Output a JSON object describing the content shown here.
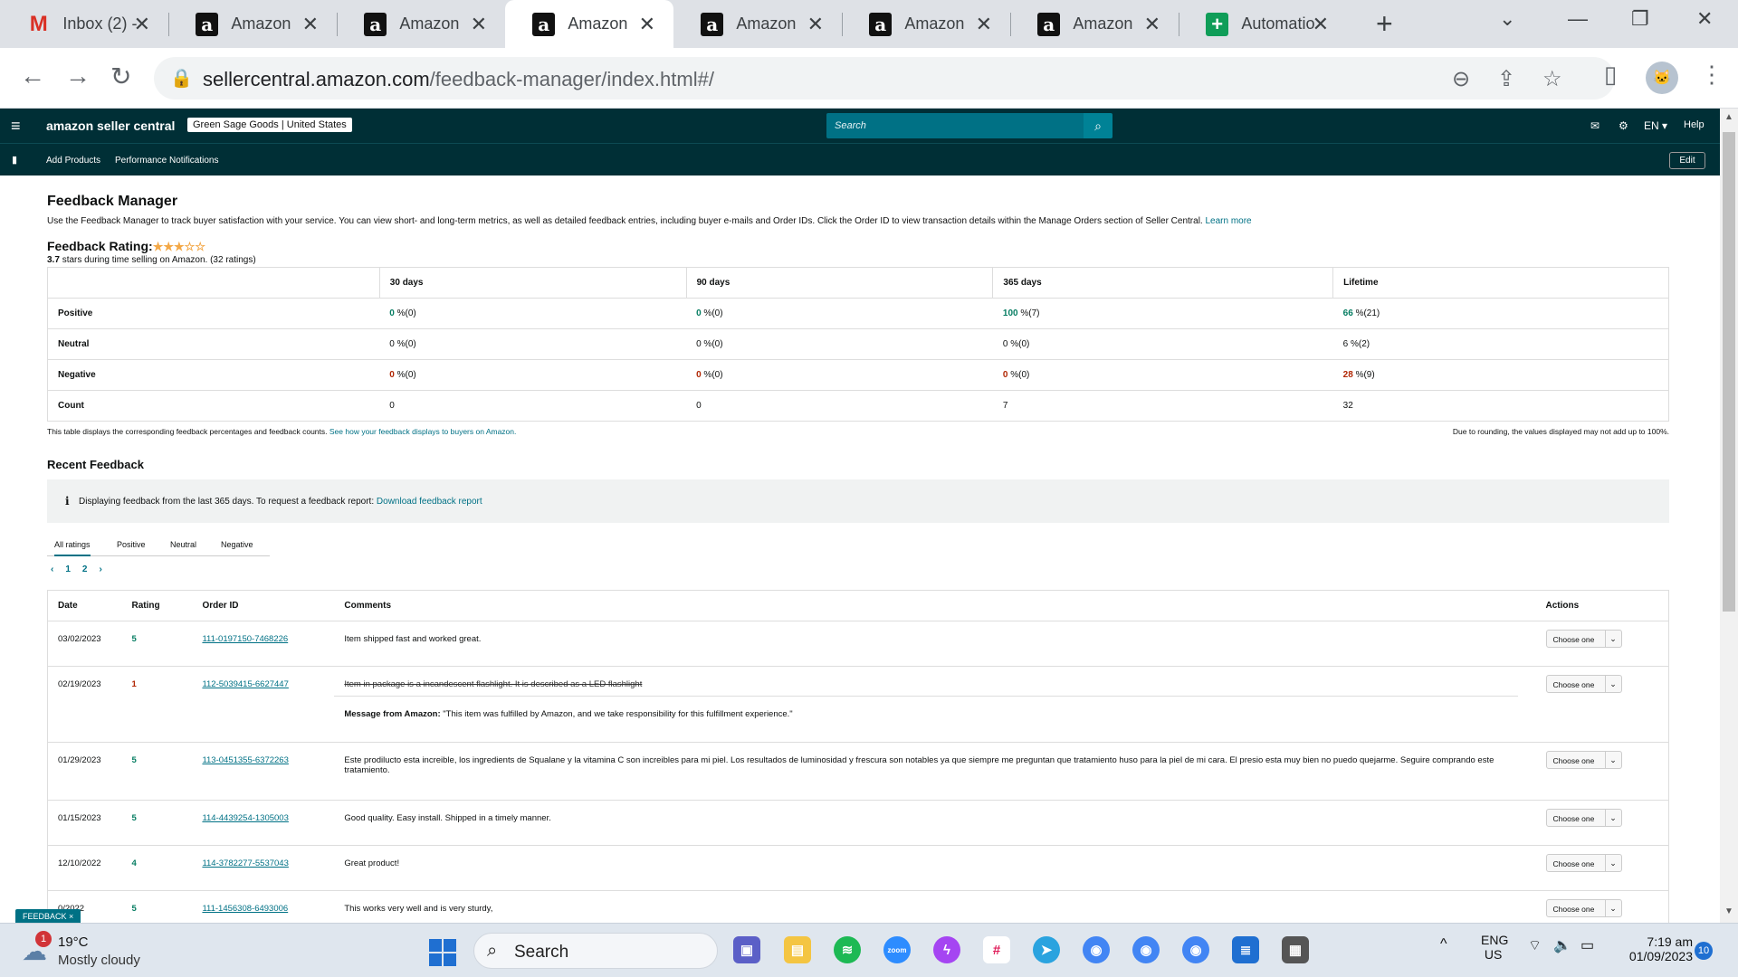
{
  "browser": {
    "tabs": [
      {
        "title": "Inbox (2) -",
        "icon": "gmail-icon"
      },
      {
        "title": "Amazon",
        "icon": "amazon-icon"
      },
      {
        "title": "Amazon",
        "icon": "amazon-icon"
      },
      {
        "title": "Amazon",
        "icon": "amazon-icon",
        "active": true
      },
      {
        "title": "Amazon",
        "icon": "amazon-icon"
      },
      {
        "title": "Amazon",
        "icon": "amazon-icon"
      },
      {
        "title": "Amazon",
        "icon": "amazon-icon"
      },
      {
        "title": "Automatio",
        "icon": "sheets-icon"
      }
    ],
    "url_host": "sellercentral.amazon.com",
    "url_path": "/feedback-manager/index.html#/"
  },
  "header": {
    "logo": "amazon seller central",
    "store": "Green Sage Goods | United States",
    "search_placeholder": "Search",
    "lang": "EN",
    "help": "Help",
    "nav": [
      "Add Products",
      "Performance Notifications"
    ],
    "edit": "Edit"
  },
  "page": {
    "title": "Feedback Manager",
    "description": "Use the Feedback Manager to track buyer satisfaction with your service. You can view short- and long-term metrics, as well as detailed feedback entries, including buyer e-mails and Order IDs. Click the Order ID to view transaction details within the Manage Orders section of Seller Central.",
    "learn_more": "Learn more",
    "rating_label": "Feedback Rating:",
    "stars": "★★★☆☆",
    "rating_value": "3.7",
    "rating_text": "stars during time selling on Amazon. (32 ratings)"
  },
  "metrics": {
    "columns": [
      "30 days",
      "90 days",
      "365 days",
      "Lifetime"
    ],
    "rows": [
      {
        "label": "Positive",
        "cells": [
          [
            "0",
            " %(0)"
          ],
          [
            "0",
            " %(0)"
          ],
          [
            "100",
            " %(7)"
          ],
          [
            "66",
            " %(21)"
          ]
        ],
        "tone": "g"
      },
      {
        "label": "Neutral",
        "cells": [
          [
            "0",
            " %(0)"
          ],
          [
            "0",
            " %(0)"
          ],
          [
            "0",
            " %(0)"
          ],
          [
            "6",
            " %(2)"
          ]
        ],
        "tone": "n"
      },
      {
        "label": "Negative",
        "cells": [
          [
            "0",
            " %(0)"
          ],
          [
            "0",
            " %(0)"
          ],
          [
            "0",
            " %(0)"
          ],
          [
            "28",
            " %(9)"
          ]
        ],
        "tone": "r"
      },
      {
        "label": "Count",
        "cells": [
          [
            "",
            "0"
          ],
          [
            "",
            "0"
          ],
          [
            "",
            "7"
          ],
          [
            "",
            "32"
          ]
        ],
        "tone": "n"
      }
    ],
    "foot_left": "This table displays the corresponding feedback percentages and feedback counts.",
    "foot_link": "See how your feedback displays to buyers on Amazon.",
    "foot_right": "Due to rounding, the values displayed may not add up to 100%."
  },
  "recent": {
    "title": "Recent Feedback",
    "info": "Displaying feedback from the last 365 days. To request a feedback report:",
    "info_link": "Download feedback report",
    "tabs": [
      "All ratings",
      "Positive",
      "Neutral",
      "Negative"
    ],
    "pages": [
      "‹",
      "1",
      "2",
      "›"
    ],
    "headers": [
      "Date",
      "Rating",
      "Order ID",
      "Comments",
      "Actions"
    ],
    "action_label": "Choose one",
    "rows": [
      {
        "date": "03/02/2023",
        "rating": "5",
        "order": "111-0197150-7468226",
        "comment": "Item shipped fast and worked great."
      },
      {
        "date": "02/19/2023",
        "rating": "1",
        "order": "112-5039415-6627447",
        "comment": "Item in package is a incandescent flashlight. It is described as a LED flashlight",
        "struck": true,
        "msg_label": "Message from Amazon:",
        "msg": "\"This item was fulfilled by Amazon, and we take responsibility for this fulfillment experience.\""
      },
      {
        "date": "01/29/2023",
        "rating": "5",
        "order": "113-0451355-6372263",
        "comment": "Este prodilucto esta increible, los ingredients de Squalane y la vitamina C son increibles para mi piel. Los resultados de luminosidad y frescura son notables ya que siempre me preguntan que tratamiento huso para la piel de mi cara. El presio esta muy bien no puedo quejarme. Seguire comprando este tratamiento."
      },
      {
        "date": "01/15/2023",
        "rating": "5",
        "order": "114-4439254-1305003",
        "comment": "Good quality. Easy install. Shipped in a timely manner."
      },
      {
        "date": "12/10/2022",
        "rating": "4",
        "order": "114-3782277-5537043",
        "comment": "Great product!"
      },
      {
        "date": "0/2022",
        "rating": "5",
        "order": "111-1456308-6493006",
        "comment": "This works very well and is very sturdy,"
      }
    ],
    "feedback_tag": "FEEDBACK ×"
  },
  "taskbar": {
    "weather_badge": "1",
    "temp": "19°C",
    "weather": "Mostly cloudy",
    "search": "Search",
    "lang1": "ENG",
    "lang2": "US",
    "time": "7:19 am",
    "date": "01/09/2023",
    "notif": "10"
  }
}
